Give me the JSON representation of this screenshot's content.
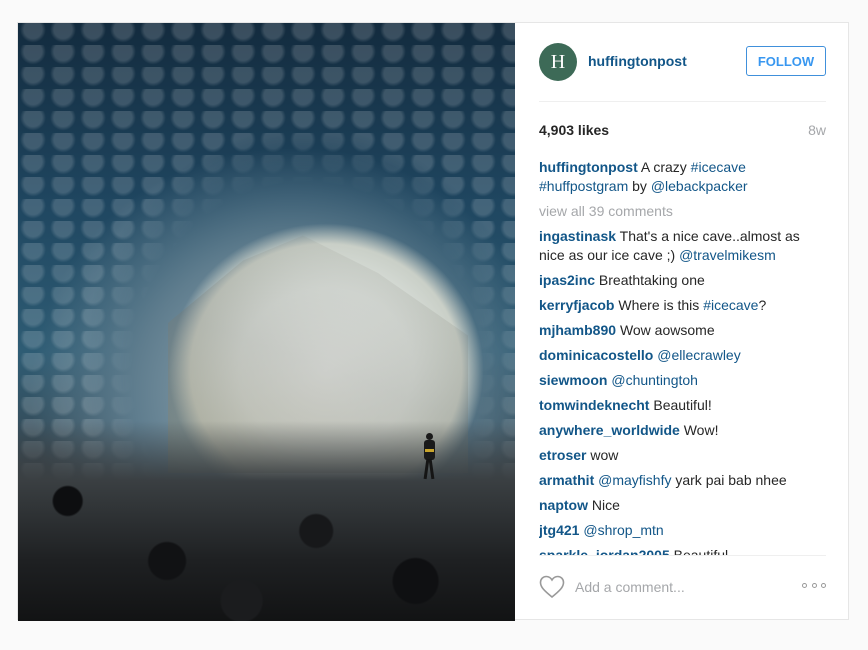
{
  "post": {
    "image_alt": "Ice cave with hiker",
    "avatar_letter": "H",
    "username": "huffingtonpost",
    "follow_label": "FOLLOW",
    "likes": "4,903 likes",
    "time_ago": "8w",
    "caption": {
      "user": "huffingtonpost",
      "text_1": "A crazy ",
      "tag_1": "#icecave",
      "text_2": " ",
      "tag_2": "#huffpostgram",
      "text_3": " by ",
      "tag_3": "@lebackpacker"
    },
    "view_all": "view all 39 comments",
    "comments": [
      {
        "user": "ingastinask",
        "text": "That's a nice cave..almost as nice as our ice cave ;) ",
        "tag": "@travelmikesm"
      },
      {
        "user": "ipas2inc",
        "text": "Breathtaking one",
        "tag": ""
      },
      {
        "user": "kerryfjacob",
        "text": "Where is this ",
        "tag": "#icecave",
        "after": "?"
      },
      {
        "user": "mjhamb890",
        "text": "Wow aowsome",
        "tag": ""
      },
      {
        "user": "dominicacostello",
        "text": "",
        "tag": "@ellecrawley"
      },
      {
        "user": "siewmoon",
        "text": "",
        "tag": "@chuntingtoh"
      },
      {
        "user": "tomwindeknecht",
        "text": "Beautiful!",
        "tag": ""
      },
      {
        "user": "anywhere_worldwide",
        "text": "Wow!",
        "tag": ""
      },
      {
        "user": "etroser",
        "text": "wow",
        "tag": ""
      },
      {
        "user": "armathit",
        "text": "",
        "tag": "@mayfishfy",
        "after": " yark pai bab nhee"
      },
      {
        "user": "naptow",
        "text": "Nice",
        "tag": ""
      },
      {
        "user": "jtg421",
        "text": "",
        "tag": "@shrop_mtn"
      },
      {
        "user": "sparkle_jordan2005",
        "text": "Beautiful",
        "tag": ""
      }
    ],
    "add_comment_placeholder": "Add a comment...",
    "icons": {
      "like": "heart-icon",
      "more": "more-options-icon"
    }
  }
}
